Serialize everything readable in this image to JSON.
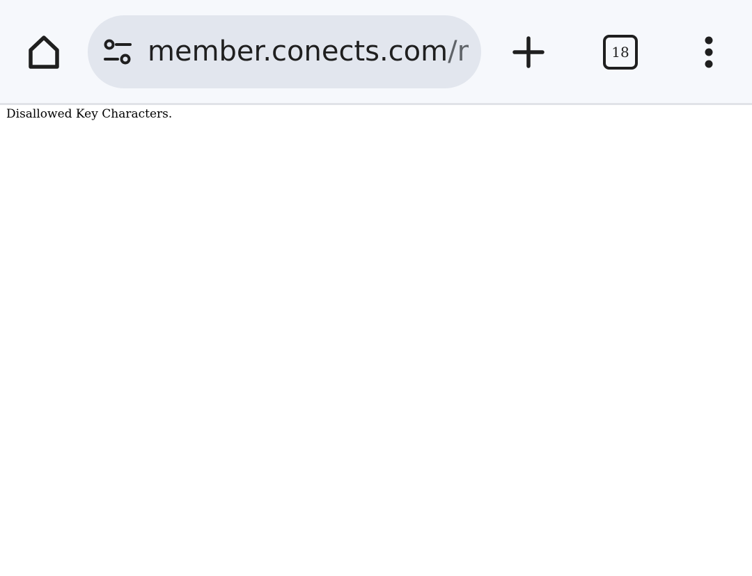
{
  "browser": {
    "toolbar": {
      "home_icon": "home-icon",
      "site_info_icon": "tune-icon",
      "url_host": "member.conects.com",
      "url_path": "/m",
      "new_tab_icon": "plus-icon",
      "tab_count": "18",
      "menu_icon": "more-vert-icon"
    }
  },
  "page": {
    "message": "Disallowed Key Characters."
  },
  "colors": {
    "toolbar_bg": "#f6f8fc",
    "omnibox_bg": "#e2e6ee",
    "icon": "#1f1f1f",
    "url_path": "#5f6368"
  }
}
